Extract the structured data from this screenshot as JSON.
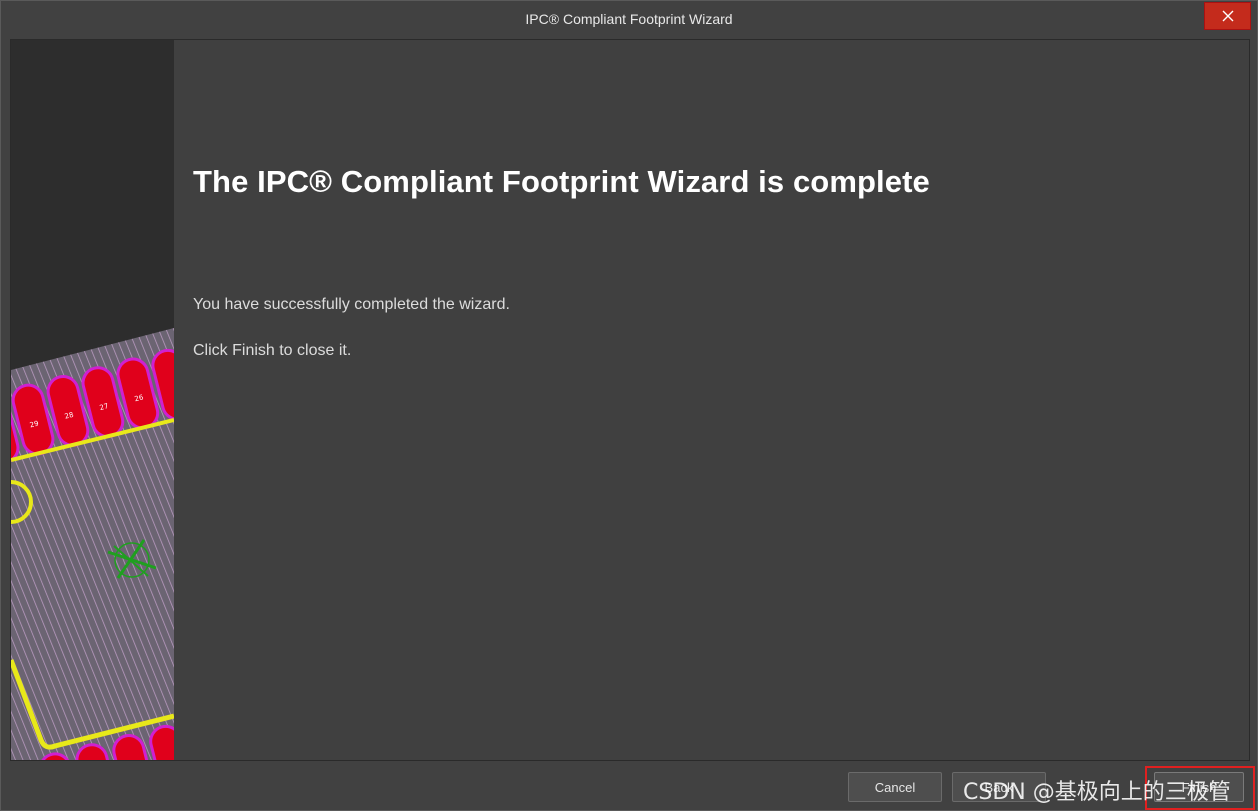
{
  "window": {
    "title": "IPC® Compliant Footprint Wizard"
  },
  "main": {
    "heading": "The IPC® Compliant Footprint Wizard is complete",
    "message": "You have successfully completed the wizard.",
    "instruction": "Click Finish to close it."
  },
  "side_image": {
    "pad_labels": [
      "29",
      "28",
      "27",
      "26"
    ]
  },
  "buttons": {
    "cancel": "Cancel",
    "back": "Back",
    "finish": "Finish"
  },
  "watermark": {
    "text": "CSDN @基极向上的三极管"
  },
  "colors": {
    "close_button": "#c42b1c",
    "pad": "#e0001b",
    "pad_outline": "#d020d0",
    "silkscreen": "#e8e81a",
    "origin_marker": "#1fa01f",
    "highlight_box": "#e02020"
  },
  "icons": {
    "close": "close-icon",
    "origin": "origin-marker-icon"
  }
}
